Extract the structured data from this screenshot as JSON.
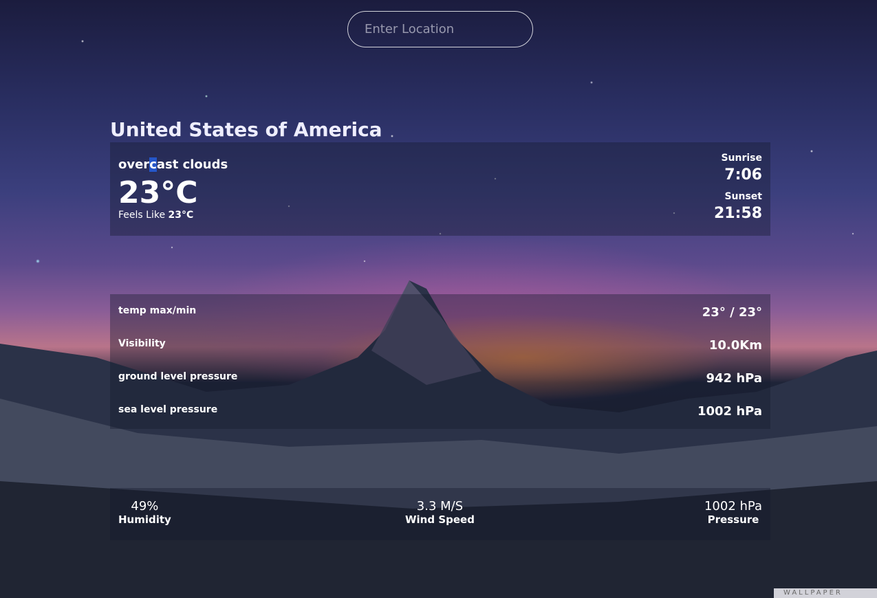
{
  "search": {
    "placeholder": "Enter Location"
  },
  "location": "United States of America",
  "current": {
    "description_pre": "over",
    "description_highlight": "c",
    "description_post": "ast clouds",
    "temperature": "23°C",
    "feels_like_label": "Feels Like",
    "feels_like_value": "23°C",
    "sunrise_label": "Sunrise",
    "sunrise_time": "7:06",
    "sunset_label": "Sunset",
    "sunset_time": "21:58"
  },
  "details": [
    {
      "label": "temp max/min",
      "value": "23° / 23°"
    },
    {
      "label": "Visibility",
      "value": "10.0Km"
    },
    {
      "label": "ground level pressure",
      "value": "942 hPa"
    },
    {
      "label": "sea level pressure",
      "value": "1002 hPa"
    }
  ],
  "stats": {
    "humidity": {
      "value": "49%",
      "label": "Humidity"
    },
    "wind": {
      "value": "3.3 M/S",
      "label": "Wind Speed"
    },
    "pressure": {
      "value": "1002 hPa",
      "label": "Pressure"
    }
  },
  "watermark": "WALLPAPER",
  "colors": {
    "selection_highlight": "#2456c9"
  }
}
